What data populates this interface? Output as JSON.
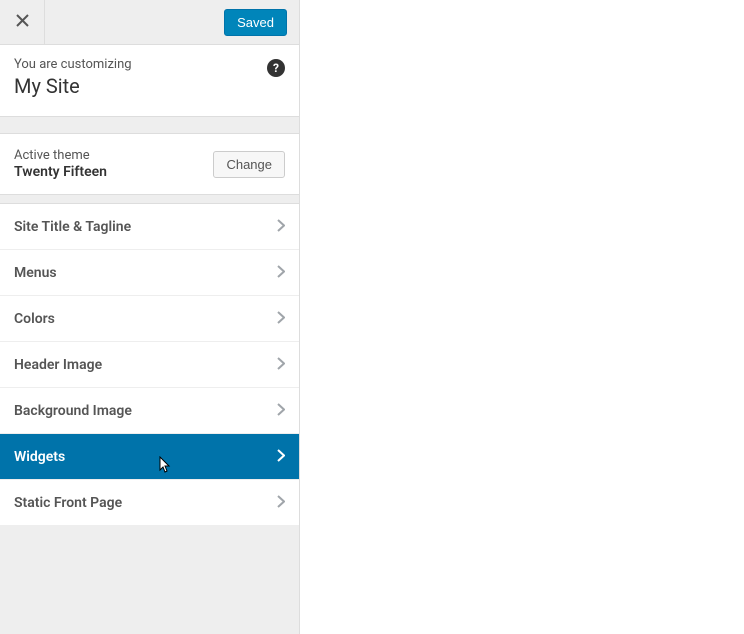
{
  "topbar": {
    "saved_label": "Saved"
  },
  "info": {
    "customizing_label": "You are customizing",
    "site_title": "My Site",
    "help_glyph": "?"
  },
  "theme": {
    "active_label": "Active theme",
    "name": "Twenty Fifteen",
    "change_label": "Change"
  },
  "sections": {
    "site_title_tagline": "Site Title & Tagline",
    "menus": "Menus",
    "colors": "Colors",
    "header_image": "Header Image",
    "background_image": "Background Image",
    "widgets": "Widgets",
    "static_front_page": "Static Front Page"
  }
}
